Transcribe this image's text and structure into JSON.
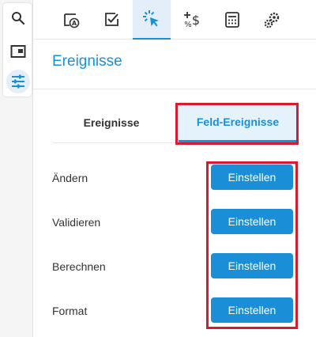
{
  "rail": {
    "items": [
      {
        "icon": "search-icon"
      },
      {
        "icon": "window-icon"
      },
      {
        "icon": "sliders-icon",
        "active": true
      }
    ]
  },
  "toolbar": {
    "tools": [
      {
        "icon": "form-field-icon"
      },
      {
        "icon": "checkbox-icon"
      },
      {
        "icon": "click-events-icon",
        "active": true
      },
      {
        "icon": "format-currency-icon"
      },
      {
        "icon": "calculator-icon"
      },
      {
        "icon": "settings-icon"
      }
    ]
  },
  "panel": {
    "title": "Ereignisse"
  },
  "tabs": [
    {
      "label": "Ereignisse",
      "active": false
    },
    {
      "label": "Feld-Ereignisse",
      "active": true
    }
  ],
  "events": [
    {
      "label": "Ändern",
      "button": "Einstellen"
    },
    {
      "label": "Validieren",
      "button": "Einstellen"
    },
    {
      "label": "Berechnen",
      "button": "Einstellen"
    },
    {
      "label": "Format",
      "button": "Einstellen"
    }
  ],
  "colors": {
    "accent": "#1a8fd8",
    "highlight": "#d9192f",
    "active_bg": "#e3eef8"
  }
}
